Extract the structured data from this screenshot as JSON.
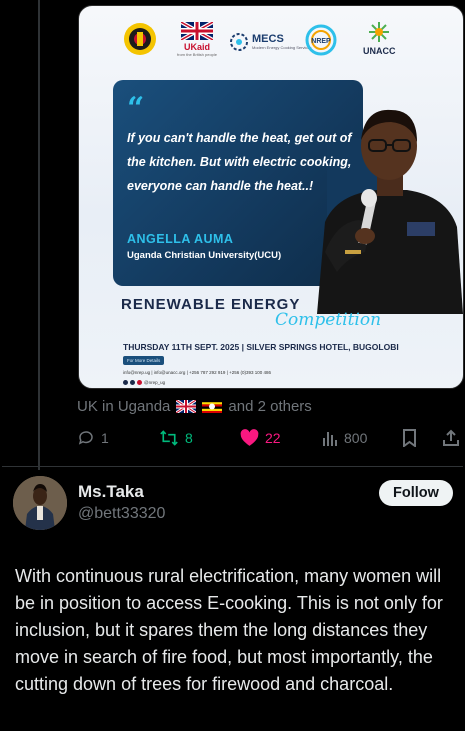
{
  "poster": {
    "logos": {
      "ukaid": "UKaid",
      "ukaid_sub": "from the British people",
      "mecs": "MECS",
      "mecs_sub": "Modern Energy Cooking Services",
      "nrep": "NREP",
      "unacc": "UNACC"
    },
    "quote": "If you can't handle the heat, get out of the kitchen. But with electric cooking, everyone can handle the heat..!",
    "speaker_name": "ANGELLA AUMA",
    "speaker_org": "Uganda Christian University(UCU)",
    "event_title": "RENEWABLE ENERGY",
    "event_script": "Competition",
    "event_date": "THURSDAY 11TH SEPT. 2025 | SILVER SPRINGS HOTEL, BUGOLOBI",
    "details_pill": "For More Details",
    "contacts": "info@nrep.ug | info@unacc.org | +256 787 292 919 | +256 (0)393 100 486",
    "socials_handle": "@nrep_ug"
  },
  "location": {
    "text": "UK in Uganda",
    "suffix": "and 2 others"
  },
  "actions": {
    "replies": "1",
    "reposts": "8",
    "likes": "22",
    "views": "800",
    "colors": {
      "muted": "#71767b",
      "repost": "#00ba7c",
      "like": "#f91880"
    }
  },
  "reply": {
    "name": "Ms.Taka",
    "handle": "@bett33320",
    "follow_label": "Follow",
    "text": "With continuous rural electrification, many women will be in position to access E-cooking. This is not only for inclusion, but it spares them the long distances they move in search of fire food, but most importantly, the cutting down of trees for firewood and charcoal."
  }
}
